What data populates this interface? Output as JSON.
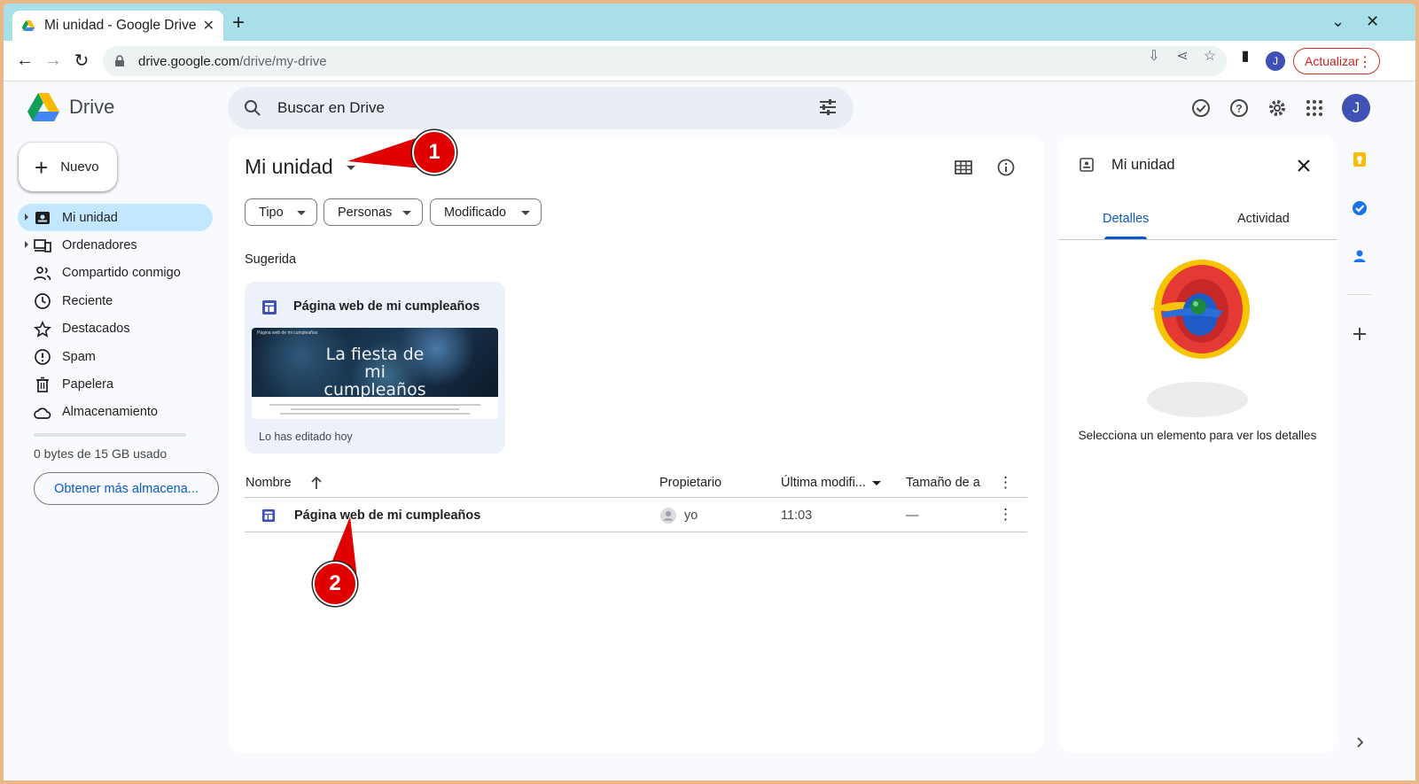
{
  "browser": {
    "tab_title": "Mi unidad - Google Drive",
    "url_host": "drive.google.com",
    "url_path": "/drive/my-drive",
    "profile_initial": "J",
    "update_label": "Actualizar"
  },
  "header": {
    "brand": "Drive",
    "search_placeholder": "Buscar en Drive",
    "avatar_initial": "J"
  },
  "sidebar": {
    "new_label": "Nuevo",
    "items": [
      {
        "label": "Mi unidad"
      },
      {
        "label": "Ordenadores"
      },
      {
        "label": "Compartido conmigo"
      },
      {
        "label": "Reciente"
      },
      {
        "label": "Destacados"
      },
      {
        "label": "Spam"
      },
      {
        "label": "Papelera"
      },
      {
        "label": "Almacenamiento"
      }
    ],
    "storage_text": "0 bytes de 15 GB usado",
    "storage_fraction": 0.0,
    "storage_button": "Obtener más almacena..."
  },
  "main": {
    "title": "Mi unidad",
    "filters": [
      "Tipo",
      "Personas",
      "Modificado"
    ],
    "suggested_label": "Sugerida",
    "suggested_card": {
      "title": "Página web de mi cumpleaños",
      "thumb_small_title": "Página web de mi cumpleaños",
      "thumb_headline": "La fiesta de mi cumpleaños",
      "footer": "Lo has editado hoy"
    },
    "table": {
      "headers": {
        "name": "Nombre",
        "owner": "Propietario",
        "modified": "Última modifi...",
        "size": "Tamaño de a"
      },
      "rows": [
        {
          "name": "Página web de mi cumpleaños",
          "owner": "yo",
          "modified": "11:03",
          "size": "—"
        }
      ]
    }
  },
  "details": {
    "title": "Mi unidad",
    "tabs": [
      "Detalles",
      "Actividad"
    ],
    "active_tab": "Detalles",
    "empty_message": "Selecciona un elemento para ver los detalles"
  },
  "annotations": [
    "1",
    "2"
  ],
  "colors": {
    "accent": "#0b57d0",
    "active_nav": "#c2e7ff",
    "callout": "#e00000",
    "tabstrip": "#a8dfe8"
  }
}
